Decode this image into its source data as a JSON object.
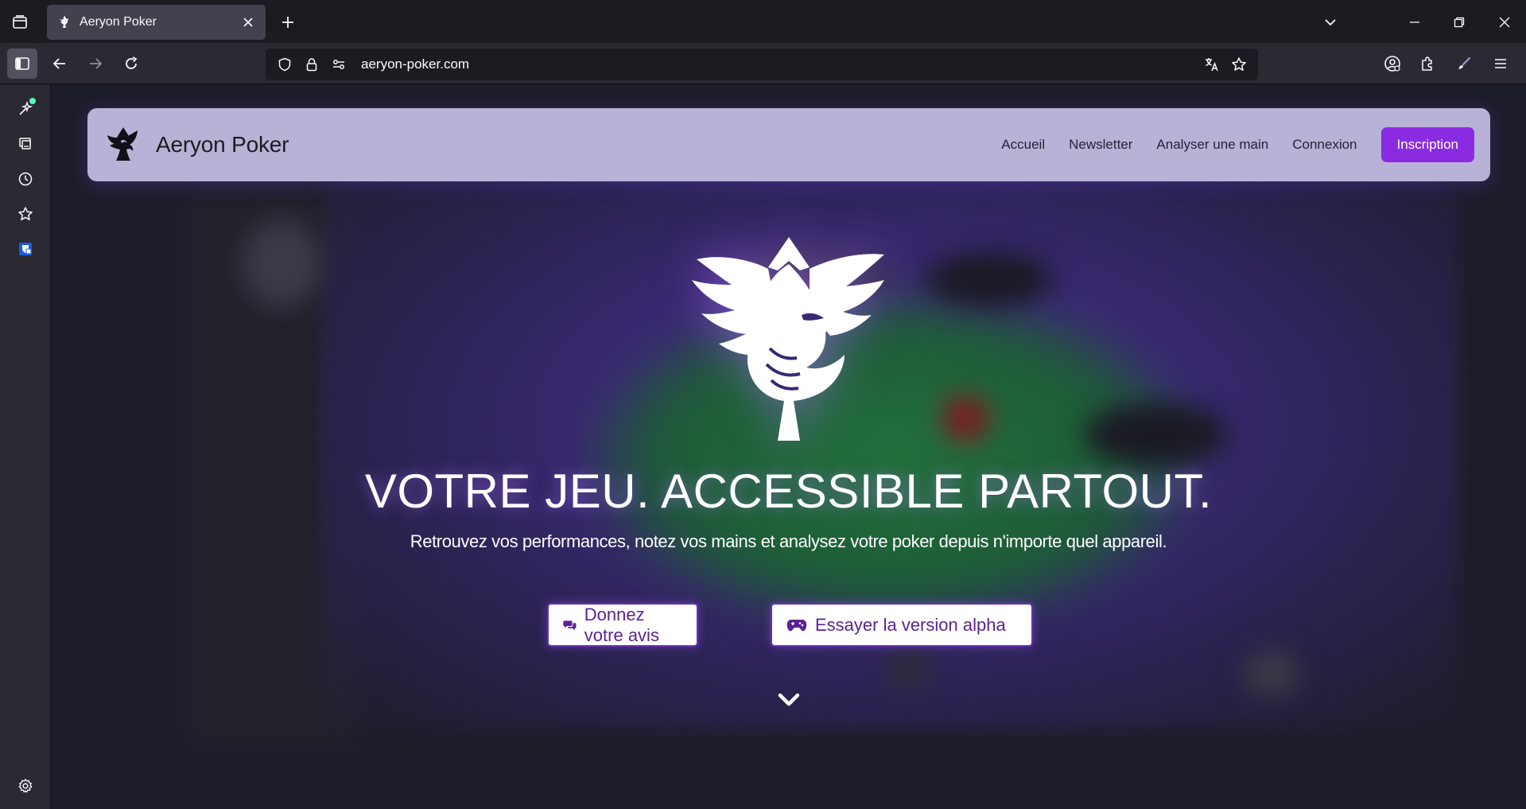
{
  "browser": {
    "tab": {
      "title": "Aeryon Poker"
    },
    "url": "aeryon-poker.com",
    "icons": {
      "tab_list": "firefox-view-icon",
      "new_tab": "plus-icon",
      "list_all_tabs": "chevron-down-icon",
      "minimize": "minimize-icon",
      "restore": "restore-icon",
      "close": "close-icon",
      "back": "arrow-left-icon",
      "forward": "arrow-right-icon",
      "reload": "reload-icon",
      "tracking": "shield-icon",
      "lock": "lock-icon",
      "permissions": "permissions-icon",
      "translate": "translate-icon",
      "bookmark": "star-icon",
      "account": "account-icon",
      "extensions": "puzzle-icon",
      "customize": "brush-icon",
      "menu": "hamburger-icon"
    },
    "sidebar": [
      {
        "name": "ai-chat-icon"
      },
      {
        "name": "synced-tabs-icon"
      },
      {
        "name": "history-icon"
      },
      {
        "name": "bookmarks-icon"
      },
      {
        "name": "bitwarden-icon"
      },
      {
        "name": "settings-icon"
      }
    ]
  },
  "site": {
    "brand": "Aeryon Poker",
    "nav": [
      "Accueil",
      "Newsletter",
      "Analyser une main",
      "Connexion"
    ],
    "signup": "Inscription",
    "hero": {
      "title": "VOTRE JEU. ACCESSIBLE PARTOUT.",
      "subtitle": "Retrouvez vos performances, notez vos mains et analysez votre poker depuis n'importe quel appareil.",
      "cta_feedback": "Donnez votre avis",
      "cta_alpha": "Essayer la version alpha"
    },
    "colors": {
      "header_bg": "#b8b2d6",
      "accent": "#8a2be2",
      "cta_text": "#5b2393"
    }
  }
}
